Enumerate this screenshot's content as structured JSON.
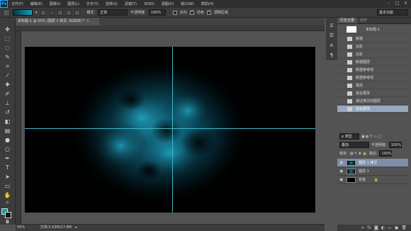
{
  "app": {
    "logo": "Ps"
  },
  "menu": [
    "文件(F)",
    "编辑(E)",
    "图像(I)",
    "图层(L)",
    "文字(Y)",
    "选择(S)",
    "滤镜(T)",
    "3D(D)",
    "视图(V)",
    "窗口(W)",
    "帮助(H)"
  ],
  "options": {
    "mode_label": "模式:",
    "mode_value": "正常",
    "opacity_label": "不透明度:",
    "opacity_value": "100%",
    "reverse_label": "反向",
    "dither_label": "仿色",
    "transparency_label": "透明区域",
    "workspace": "基本功能"
  },
  "document": {
    "tab_title": "未标题-1 @ 50% (图层 1 拷贝, RGB/8) *",
    "zoom": "50%",
    "doc_info": "文档:5.93M/17.8M"
  },
  "history": {
    "tabs": [
      "历史记录",
      "动作"
    ],
    "snapshot_label": "未标题-1",
    "items": [
      "新建",
      "云彩",
      "云彩",
      "新建图层",
      "新建参考线",
      "新建参考线",
      "填充",
      "混合更改",
      "通过拷贝的图层",
      "混合更改"
    ]
  },
  "layers": {
    "tabs": [
      "图层",
      "通道",
      "路径"
    ],
    "kind_label": "ρ 类型",
    "blend_mode": "叠加",
    "opacity_label": "不透明度:",
    "opacity_value": "100%",
    "lock_label": "锁定:",
    "fill_label": "填充:",
    "fill_value": "100%",
    "items": [
      {
        "name": "图层 1 拷贝",
        "active": true
      },
      {
        "name": "图层 1",
        "active": false
      },
      {
        "name": "背景",
        "active": false
      }
    ]
  },
  "colors": {
    "foreground": "#0e9bb2",
    "background": "#111111",
    "guide": "#3fb8c8",
    "accent": "#98a8bf"
  }
}
